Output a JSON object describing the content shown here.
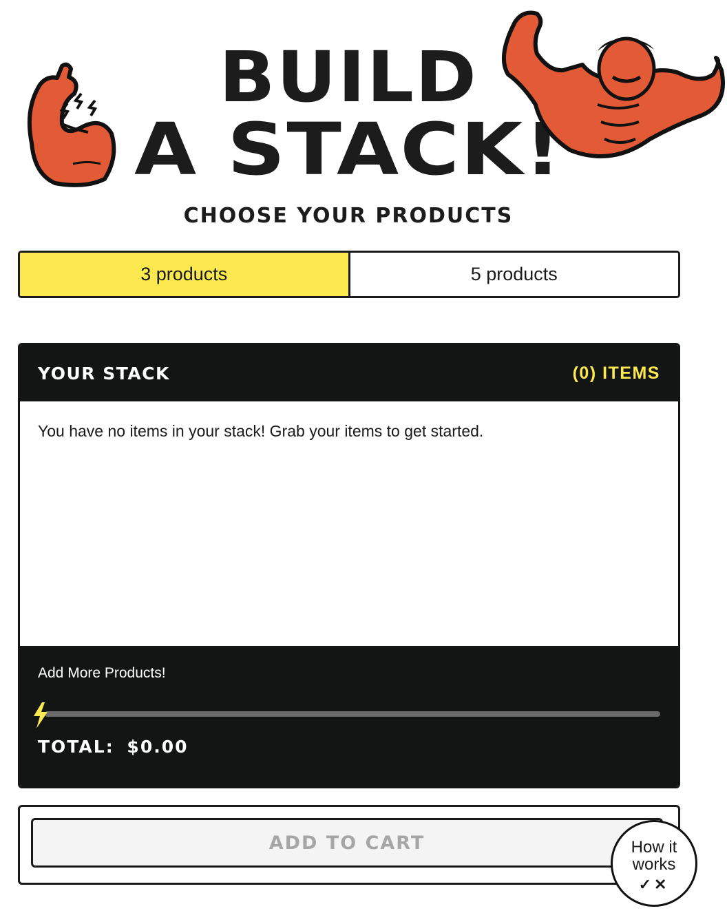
{
  "hero": {
    "title_line1": "BUILD",
    "title_line2": "A STACK!",
    "subtitle": "CHOOSE YOUR PRODUCTS",
    "left_illustration": "flexing-arm-icon",
    "right_illustration": "strongman-icon"
  },
  "tabs": [
    {
      "label": "3 products",
      "selected": true
    },
    {
      "label": "5 products",
      "selected": false
    }
  ],
  "stack": {
    "title": "YOUR STACK",
    "count_label": "(0) ITEMS",
    "empty_message": "You have no items in your stack! Grab your items to get started.",
    "add_more_label": "Add More Products!",
    "progress": 0,
    "progress_icon": "lightning-bolt-icon",
    "total_label": "TOTAL:",
    "total_value": "$0.00"
  },
  "cart": {
    "button_label": "ADD TO CART",
    "disabled": true
  },
  "help": {
    "label": "How it works",
    "icons": "✓✕"
  },
  "colors": {
    "accent_yellow": "#fbe94f",
    "dark": "#131515",
    "mascot_orange": "#e35a36"
  }
}
